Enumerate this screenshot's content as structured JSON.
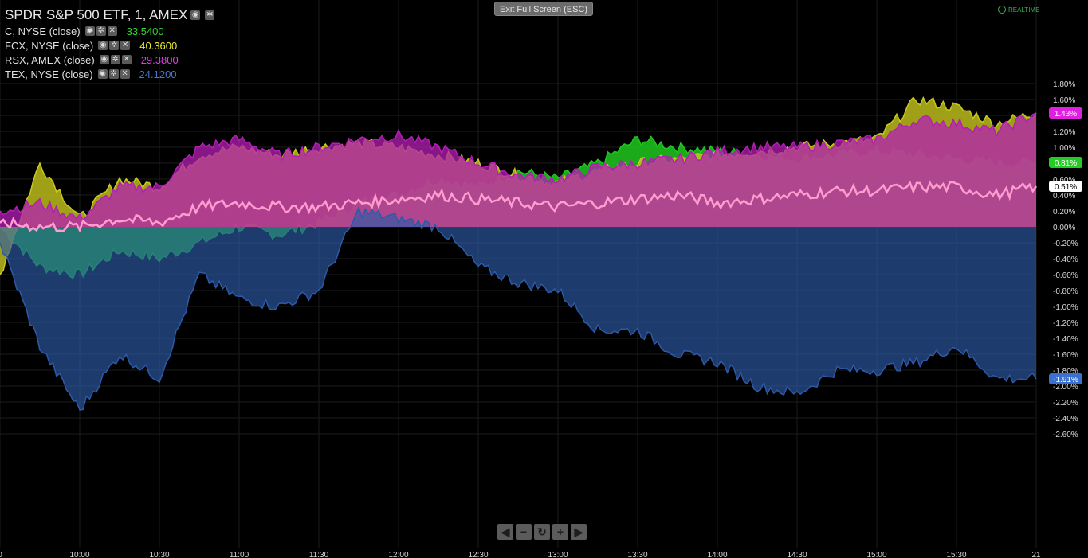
{
  "toolbar": {
    "exit_label": "Exit Full Screen (ESC)",
    "realtime_label": "REALTIME"
  },
  "legend": {
    "title": "SPDR S&P 500 ETF, 1, AMEX",
    "rows": [
      {
        "name": "C, NYSE (close)",
        "value": "33.5400",
        "color": "#33d633"
      },
      {
        "name": "FCX, NYSE (close)",
        "value": "40.3600",
        "color": "#e8e833"
      },
      {
        "name": "RSX, AMEX (close)",
        "value": "29.3800",
        "color": "#e040e0"
      },
      {
        "name": "TEX, NYSE (close)",
        "value": "24.1200",
        "color": "#4a78d0"
      }
    ]
  },
  "nav": [
    "◀",
    "−",
    "↻",
    "+",
    "▶"
  ],
  "chart_data": {
    "type": "area",
    "y_unit": "%",
    "ylim": [
      -2.7,
      1.9
    ],
    "y_ticks": [
      "1.80%",
      "1.60%",
      "1.40%",
      "1.20%",
      "1.00%",
      "0.80%",
      "0.60%",
      "0.40%",
      "0.20%",
      "0.00%",
      "-0.20%",
      "-0.40%",
      "-0.60%",
      "-0.80%",
      "-1.00%",
      "-1.20%",
      "-1.40%",
      "-1.60%",
      "-1.80%",
      "-2.00%",
      "-2.20%",
      "-2.40%",
      "-2.60%"
    ],
    "x_ticks": [
      "0",
      "10:00",
      "10:30",
      "11:00",
      "11:30",
      "12:00",
      "12:30",
      "13:00",
      "13:30",
      "14:00",
      "14:30",
      "15:00",
      "15:30",
      "21"
    ],
    "grid": true,
    "series": [
      {
        "name": "C, NYSE (close)",
        "color": "#1ec81e",
        "x": [
          "9:30",
          "9:45",
          "10:00",
          "10:15",
          "10:30",
          "10:45",
          "11:00",
          "11:15",
          "11:30",
          "11:45",
          "12:00",
          "12:15",
          "12:30",
          "12:45",
          "13:00",
          "13:15",
          "13:30",
          "13:45",
          "14:00",
          "14:15",
          "14:30",
          "14:45",
          "15:00",
          "15:15",
          "15:30",
          "15:45",
          "16:00"
        ],
        "values": [
          0.0,
          -0.5,
          -0.6,
          -0.3,
          -0.4,
          -0.2,
          0.0,
          -0.1,
          0.05,
          0.3,
          0.4,
          0.6,
          0.5,
          0.7,
          0.6,
          0.8,
          1.1,
          1.0,
          0.95,
          0.9,
          0.85,
          0.9,
          0.95,
          0.9,
          0.85,
          0.8,
          0.81
        ]
      },
      {
        "name": "FCX, NYSE (close)",
        "color": "#c8c81e",
        "x": [
          "9:30",
          "9:45",
          "10:00",
          "10:15",
          "10:30",
          "10:45",
          "11:00",
          "11:15",
          "11:30",
          "11:45",
          "12:00",
          "12:15",
          "12:30",
          "12:45",
          "13:00",
          "13:15",
          "13:30",
          "13:45",
          "14:00",
          "14:15",
          "14:30",
          "14:45",
          "15:00",
          "15:15",
          "15:30",
          "15:45",
          "16:00"
        ],
        "values": [
          -0.6,
          0.8,
          0.1,
          0.6,
          0.5,
          0.9,
          1.0,
          0.9,
          1.0,
          1.05,
          1.0,
          0.9,
          0.8,
          0.65,
          0.55,
          0.7,
          0.8,
          0.85,
          0.9,
          0.95,
          1.0,
          1.05,
          1.1,
          1.6,
          1.5,
          1.3,
          1.43
        ]
      },
      {
        "name": "RSX, AMEX (close)",
        "color": "#b41eb4",
        "x": [
          "9:30",
          "9:45",
          "10:00",
          "10:15",
          "10:30",
          "10:45",
          "11:00",
          "11:15",
          "11:30",
          "11:45",
          "12:00",
          "12:15",
          "12:30",
          "12:45",
          "13:00",
          "13:15",
          "13:30",
          "13:45",
          "14:00",
          "14:15",
          "14:30",
          "14:45",
          "15:00",
          "15:15",
          "15:30",
          "15:45",
          "16:00"
        ],
        "values": [
          0.2,
          0.3,
          0.1,
          0.5,
          0.5,
          1.0,
          1.1,
          0.9,
          1.0,
          1.1,
          1.15,
          1.0,
          0.8,
          0.65,
          0.6,
          0.75,
          0.8,
          0.85,
          0.95,
          1.0,
          1.0,
          1.05,
          1.1,
          1.35,
          1.3,
          1.2,
          1.43
        ]
      },
      {
        "name": "TEX, NYSE (close)",
        "color": "#2c5aa8",
        "x": [
          "9:30",
          "9:45",
          "10:00",
          "10:15",
          "10:30",
          "10:45",
          "11:00",
          "11:15",
          "11:30",
          "11:45",
          "12:00",
          "12:15",
          "12:30",
          "12:45",
          "13:00",
          "13:15",
          "13:30",
          "13:45",
          "14:00",
          "14:15",
          "14:30",
          "14:45",
          "15:00",
          "15:15",
          "15:30",
          "15:45",
          "16:00"
        ],
        "values": [
          -0.2,
          -1.5,
          -2.3,
          -1.6,
          -1.9,
          -0.6,
          -0.9,
          -1.0,
          -0.8,
          0.2,
          0.1,
          0.0,
          -0.5,
          -0.7,
          -0.8,
          -1.3,
          -1.3,
          -1.6,
          -1.7,
          -2.0,
          -2.1,
          -1.8,
          -1.8,
          -1.7,
          -1.5,
          -1.9,
          -1.91
        ]
      },
      {
        "name": "SPDR S&P 500 ETF",
        "color": "#ff9cd0",
        "x": [
          "9:30",
          "9:45",
          "10:00",
          "10:15",
          "10:30",
          "10:45",
          "11:00",
          "11:15",
          "11:30",
          "11:45",
          "12:00",
          "12:15",
          "12:30",
          "12:45",
          "13:00",
          "13:15",
          "13:30",
          "13:45",
          "14:00",
          "14:15",
          "14:30",
          "14:45",
          "15:00",
          "15:15",
          "15:30",
          "15:45",
          "16:00"
        ],
        "values": [
          0.05,
          0.0,
          0.0,
          0.1,
          0.05,
          0.25,
          0.3,
          0.25,
          0.25,
          0.3,
          0.35,
          0.4,
          0.35,
          0.3,
          0.25,
          0.3,
          0.35,
          0.4,
          0.3,
          0.35,
          0.4,
          0.45,
          0.45,
          0.5,
          0.5,
          0.4,
          0.51
        ]
      }
    ],
    "last_labels": [
      {
        "text": "1.43%",
        "color": "#e020e0",
        "value": 1.43
      },
      {
        "text": "0.81%",
        "color": "#22cc22",
        "value": 0.81
      },
      {
        "text": "0.51%",
        "color": "#ffffff",
        "value": 0.51
      },
      {
        "text": "-1.91%",
        "color": "#3a70d0",
        "value": -1.91
      }
    ]
  }
}
